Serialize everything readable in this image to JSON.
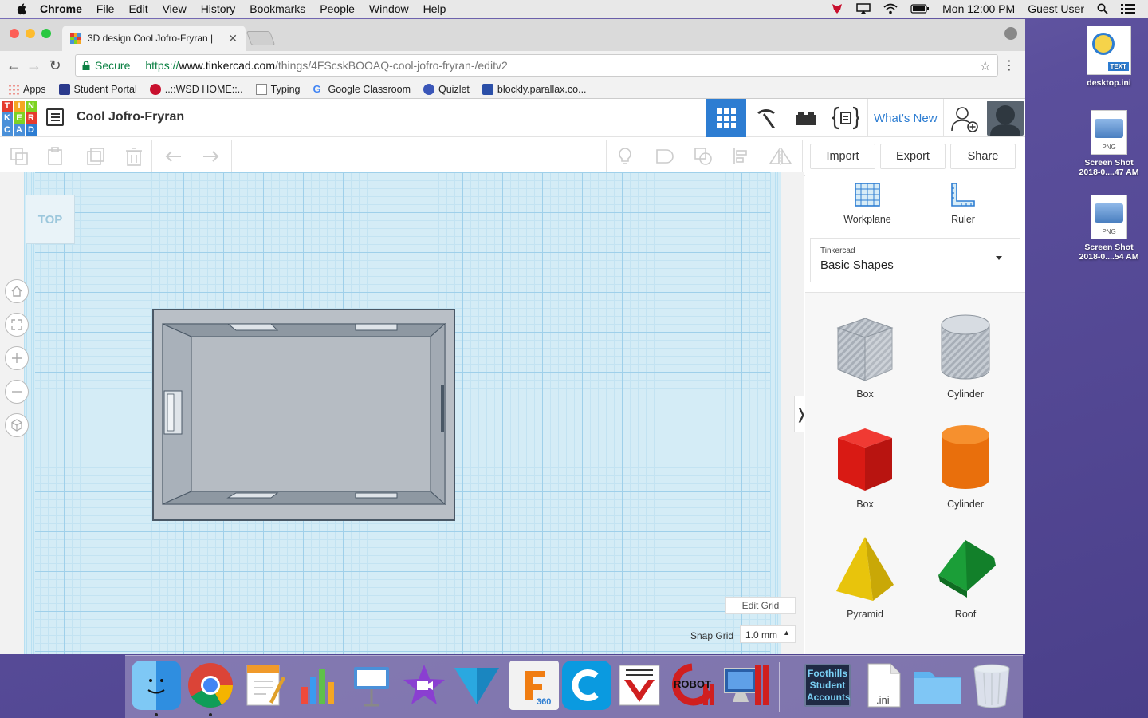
{
  "menubar": {
    "app": "Chrome",
    "items": [
      "File",
      "Edit",
      "View",
      "History",
      "Bookmarks",
      "People",
      "Window",
      "Help"
    ],
    "clock": "Mon 12:00 PM",
    "user": "Guest User"
  },
  "browser": {
    "tab_title": "3D design Cool Jofro-Fryran |",
    "secure_label": "Secure",
    "url_scheme": "https://",
    "url_host": "www.tinkercad.com",
    "url_path": "/things/4FScskBOOAQ-cool-jofro-fryran-/editv2",
    "bookmarks": [
      {
        "label": "Apps"
      },
      {
        "label": "Student Portal"
      },
      {
        "label": "..::WSD HOME::.."
      },
      {
        "label": "Typing"
      },
      {
        "label": "Google Classroom"
      },
      {
        "label": "Quizlet"
      },
      {
        "label": "blockly.parallax.co..."
      }
    ]
  },
  "tinkercad": {
    "logo_letters": [
      "T",
      "I",
      "N",
      "K",
      "E",
      "R",
      "C",
      "A",
      "D"
    ],
    "design_title": "Cool Jofro-Fryran",
    "whats_new": "What's New",
    "actions": {
      "import": "Import",
      "export": "Export",
      "share": "Share"
    },
    "viewcube_label": "TOP",
    "snap_grid_label": "Snap Grid",
    "snap_grid_value": "1.0 mm",
    "edit_grid": "Edit Grid",
    "panel": {
      "workplane": "Workplane",
      "ruler": "Ruler",
      "library_source": "Tinkercad",
      "library_name": "Basic Shapes",
      "shapes": [
        {
          "label": "Box",
          "color": "#b8bec6"
        },
        {
          "label": "Cylinder",
          "color": "#c6cbd2"
        },
        {
          "label": "Box",
          "color": "#e0201b"
        },
        {
          "label": "Cylinder",
          "color": "#f07d12"
        },
        {
          "label": "Pyramid",
          "color": "#f2d21a"
        },
        {
          "label": "Roof",
          "color": "#1fa23a"
        }
      ]
    }
  },
  "desktop": {
    "icons": [
      {
        "label": "desktop.ini",
        "badge": "TEXT"
      },
      {
        "label": "Screen Shot 2018-0....47 AM",
        "badge": "PNG"
      },
      {
        "label": "Screen Shot 2018-0....54 AM",
        "badge": "PNG"
      }
    ]
  },
  "dock": {
    "fusion_badge": "360",
    "robot_label": "ROBOT",
    "accounts_label": "Foothills Student Accounts",
    "ini_label": ".ini"
  }
}
